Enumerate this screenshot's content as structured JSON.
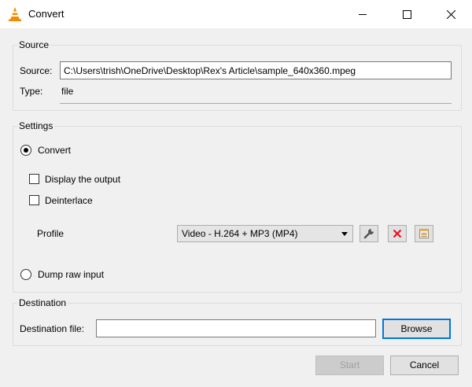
{
  "window": {
    "title": "Convert",
    "icon": "vlc-cone-icon",
    "controls": [
      "minimize-icon",
      "maximize-icon",
      "close-icon"
    ]
  },
  "source_group": {
    "title": "Source",
    "source_label": "Source:",
    "source_value": "C:\\Users\\trish\\OneDrive\\Desktop\\Rex's Article\\sample_640x360.mpeg",
    "type_label": "Type:",
    "type_value": "file"
  },
  "settings_group": {
    "title": "Settings",
    "convert_label": "Convert",
    "convert_selected": true,
    "display_output_label": "Display the output",
    "display_output_checked": false,
    "deinterlace_label": "Deinterlace",
    "deinterlace_checked": false,
    "profile_label": "Profile",
    "profile_value": "Video - H.264 + MP3 (MP4)",
    "profile_tools": [
      "wrench-icon",
      "delete-icon",
      "new-profile-icon"
    ],
    "dump_raw_label": "Dump raw input",
    "dump_raw_selected": false
  },
  "destination_group": {
    "title": "Destination",
    "dest_label": "Destination file:",
    "dest_value": "",
    "browse_label": "Browse"
  },
  "footer": {
    "start_label": "Start",
    "cancel_label": "Cancel"
  },
  "colors": {
    "accent": "#0078d7",
    "delete": "#e81123",
    "vlc_orange": "#f18b00"
  }
}
